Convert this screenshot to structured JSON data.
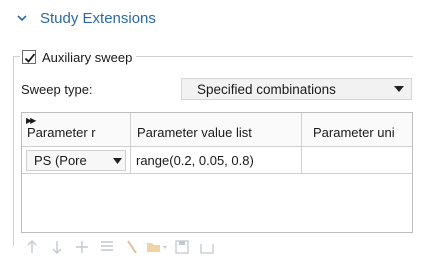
{
  "section": {
    "title": "Study Extensions",
    "expanded": true
  },
  "aux_sweep": {
    "label": "Auxiliary sweep",
    "checked": true
  },
  "sweep_type": {
    "label": "Sweep type:",
    "value": "Specified combinations"
  },
  "table": {
    "headers": [
      "Parameter r",
      "Parameter value list",
      "Parameter uni"
    ],
    "rows": [
      {
        "param": "PS (Pore",
        "values": "range(0.2, 0.05, 0.8)",
        "unit": ""
      }
    ]
  },
  "toolbar": {
    "buttons": [
      "move-up-icon",
      "move-down-icon",
      "add-icon",
      "list-icon",
      "clear-icon",
      "load-from-file-icon",
      "save-icon",
      "save-to-file-icon"
    ],
    "state": "disabled"
  },
  "colors": {
    "accent": "#2b6aa6",
    "border": "#cfcfcf",
    "header_bg": "#fafafa"
  }
}
